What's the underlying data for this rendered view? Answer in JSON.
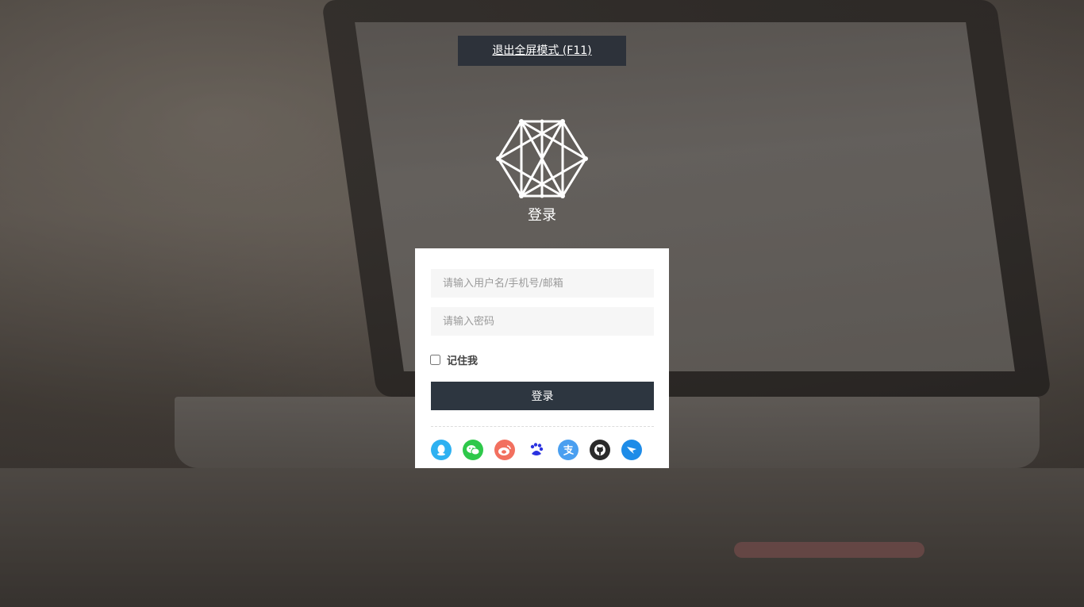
{
  "header": {
    "exit_fullscreen_label": "退出全屏模式 (F11)"
  },
  "logo": {
    "title": "登录"
  },
  "login_form": {
    "username_placeholder": "请输入用户名/手机号/邮箱",
    "password_placeholder": "请输入密码",
    "remember_label": "记住我",
    "remember_checked": false,
    "submit_label": "登录"
  },
  "social_logins": [
    {
      "icon": "qq-icon",
      "color": "#2eb1f1"
    },
    {
      "icon": "wechat-icon",
      "color": "#2ec84a"
    },
    {
      "icon": "weibo-icon",
      "color": "#f2705f"
    },
    {
      "icon": "baidu-icon",
      "color": "#2a32e0"
    },
    {
      "icon": "alipay-icon",
      "color": "#4a9ff0"
    },
    {
      "icon": "github-icon",
      "color": "#2b2b2b"
    },
    {
      "icon": "dingtalk-icon",
      "color": "#1e8ce8"
    }
  ]
}
